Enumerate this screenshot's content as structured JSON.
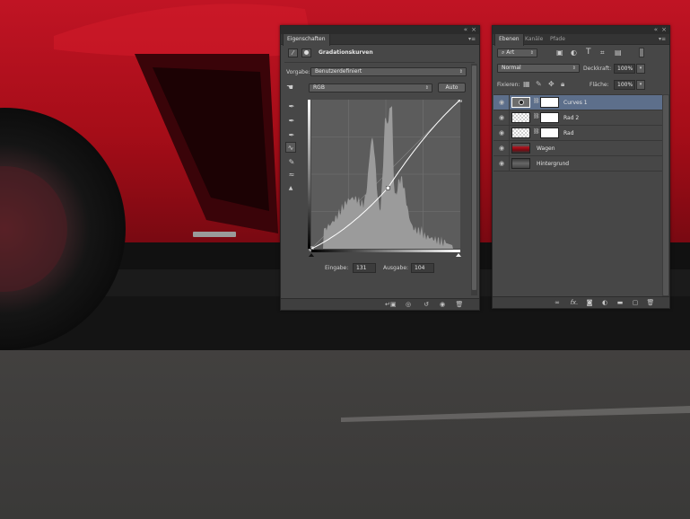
{
  "properties_panel": {
    "tabs": [
      {
        "label": "Eigenschaften",
        "active": true
      }
    ],
    "title": "Gradationskurven",
    "preset_label": "Vorgabe:",
    "preset_value": "Benutzerdefiniert",
    "channel_value": "RGB",
    "auto_label": "Auto",
    "input_label": "Eingabe:",
    "input_value": "131",
    "output_label": "Ausgabe:",
    "output_value": "104",
    "tools": [
      "hand-adjust-icon",
      "eyedropper-black-icon",
      "eyedropper-gray-icon",
      "eyedropper-white-icon",
      "curve-points-icon",
      "pencil-icon",
      "smooth-icon",
      "clipping-warning-icon"
    ],
    "bottom_icons": [
      "clip-to-layer-icon",
      "view-previous-icon",
      "reset-icon",
      "visibility-eye-icon",
      "trash-icon"
    ],
    "curve": {
      "control_point": {
        "input": 131,
        "output": 104
      },
      "max": 255
    }
  },
  "layers_panel": {
    "tabs": [
      {
        "label": "Ebenen",
        "active": true
      },
      {
        "label": "Kanäle",
        "active": false
      },
      {
        "label": "Pfade",
        "active": false
      }
    ],
    "filter_value": "Art",
    "blend_mode": "Normal",
    "opacity_label": "Deckkraft:",
    "opacity_value": "100%",
    "lock_label": "Fixieren:",
    "fill_label": "Fläche:",
    "fill_value": "100%",
    "layers": [
      {
        "name": "Curves 1",
        "type": "adjustment",
        "selected": true
      },
      {
        "name": "Rad 2",
        "type": "mask",
        "selected": false
      },
      {
        "name": "Rad",
        "type": "mask",
        "selected": false
      },
      {
        "name": "Wagen",
        "type": "image",
        "selected": false
      },
      {
        "name": "Hintergrund",
        "type": "image",
        "selected": false
      }
    ],
    "bottom_icons": [
      "link-icon",
      "fx-icon",
      "add-mask-icon",
      "adjustment-layer-icon",
      "group-folder-icon",
      "new-layer-icon",
      "trash-icon"
    ]
  },
  "colors": {
    "car_red": "#b0101c",
    "panel_bg": "#474747",
    "selected_layer": "#5d6f8b"
  }
}
